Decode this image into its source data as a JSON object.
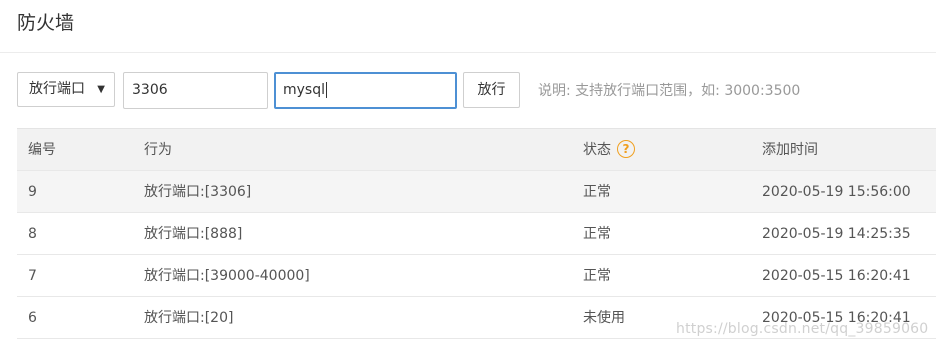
{
  "page": {
    "title": "防火墙"
  },
  "form": {
    "type_select": {
      "value": "放行端口"
    },
    "port_input": {
      "value": "3306"
    },
    "note_input": {
      "value": "mysql"
    },
    "submit_label": "放行",
    "hint": "说明: 支持放行端口范围，如: 3000:3500"
  },
  "table": {
    "headers": {
      "id": "编号",
      "action": "行为",
      "status": "状态",
      "time": "添加时间"
    },
    "rows": [
      {
        "id": "9",
        "action": "放行端口:[3306]",
        "status": "正常",
        "time": "2020-05-19 15:56:00"
      },
      {
        "id": "8",
        "action": "放行端口:[888]",
        "status": "正常",
        "time": "2020-05-19 14:25:35"
      },
      {
        "id": "7",
        "action": "放行端口:[39000-40000]",
        "status": "正常",
        "time": "2020-05-15 16:20:41"
      },
      {
        "id": "6",
        "action": "放行端口:[20]",
        "status": "未使用",
        "time": "2020-05-15 16:20:41"
      }
    ]
  },
  "watermark": "https://blog.csdn.net/qq_39859060",
  "icons": {
    "status_help": "question-circle-icon",
    "select_caret": "caret-down-icon"
  },
  "colors": {
    "accent_focus": "#4d90d4",
    "help_icon": "#f0a020"
  }
}
